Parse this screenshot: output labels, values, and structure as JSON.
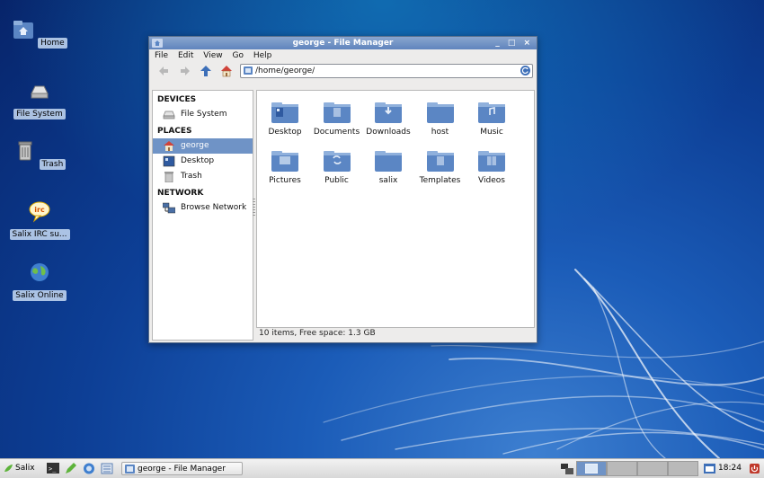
{
  "desktop": {
    "icons": [
      {
        "label": "Home"
      },
      {
        "label": "File System"
      },
      {
        "label": "Trash"
      },
      {
        "label": "Salix IRC su..."
      },
      {
        "label": "Salix Online"
      }
    ]
  },
  "window": {
    "title": "george - File Manager",
    "controls": "_ □ ×",
    "menu": [
      "File",
      "Edit",
      "View",
      "Go",
      "Help"
    ],
    "location": "/home/george/",
    "status": "10 items, Free space: 1.3 GB"
  },
  "sidebar": {
    "devices_header": "DEVICES",
    "devices": [
      {
        "label": "File System",
        "icon": "drive-icon"
      }
    ],
    "places_header": "PLACES",
    "places": [
      {
        "label": "george",
        "icon": "home-icon",
        "selected": true
      },
      {
        "label": "Desktop",
        "icon": "desktop-icon"
      },
      {
        "label": "Trash",
        "icon": "trash-icon"
      }
    ],
    "network_header": "NETWORK",
    "network": [
      {
        "label": "Browse Network",
        "icon": "network-icon"
      }
    ]
  },
  "folders": [
    {
      "label": "Desktop",
      "glyph": "desktop"
    },
    {
      "label": "Documents",
      "glyph": "documents"
    },
    {
      "label": "Downloads",
      "glyph": "download"
    },
    {
      "label": "host",
      "glyph": "none"
    },
    {
      "label": "Music",
      "glyph": "music"
    },
    {
      "label": "Pictures",
      "glyph": "pictures"
    },
    {
      "label": "Public",
      "glyph": "public"
    },
    {
      "label": "salix",
      "glyph": "none"
    },
    {
      "label": "Templates",
      "glyph": "templates"
    },
    {
      "label": "Videos",
      "glyph": "videos"
    }
  ],
  "taskbar": {
    "start_label": "Salix",
    "task_label": "george - File Manager",
    "clock": "18:24"
  },
  "colors": {
    "folder_top": "#8fb0dc",
    "folder_body": "#5b86c4",
    "selection": "#6f93c6",
    "titlebar": "#6d8fc6"
  }
}
